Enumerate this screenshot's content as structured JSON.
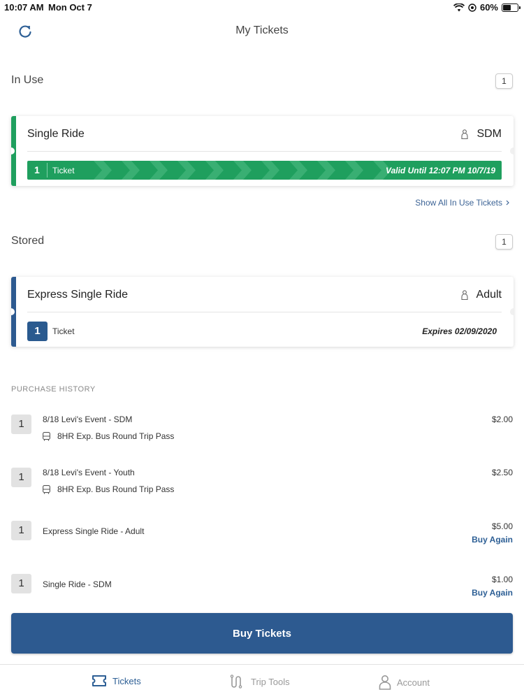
{
  "status_bar": {
    "time": "10:07 AM",
    "date": "Mon Oct 7",
    "battery": "60%",
    "battery_level": 0.6
  },
  "header": {
    "title": "My Tickets",
    "refresh_icon": "refresh-icon"
  },
  "in_use": {
    "title": "In Use",
    "count": "1",
    "ticket": {
      "name": "Single Ride",
      "rider_type": "SDM",
      "quantity": "1",
      "label": "Ticket",
      "validity": "Valid Until 12:07 PM 10/7/19"
    },
    "show_all": "Show All In Use Tickets"
  },
  "stored": {
    "title": "Stored",
    "count": "1",
    "ticket": {
      "name": "Express Single Ride",
      "rider_type": "Adult",
      "quantity": "1",
      "label": "Ticket",
      "expiry": "Expires 02/09/2020"
    }
  },
  "purchase_history": {
    "header": "PURCHASE HISTORY",
    "items": [
      {
        "qty": "1",
        "title": "8/18 Levi's Event  -  SDM",
        "sub": "8HR Exp. Bus Round Trip Pass",
        "price": "$2.00",
        "action": ""
      },
      {
        "qty": "1",
        "title": "8/18 Levi's Event  -  Youth",
        "sub": "8HR Exp. Bus Round Trip Pass",
        "price": "$2.50",
        "action": ""
      },
      {
        "qty": "1",
        "title": "Express Single Ride  -  Adult",
        "sub": "",
        "price": "$5.00",
        "action": "Buy Again"
      },
      {
        "qty": "1",
        "title": "Single Ride  -  SDM",
        "sub": "",
        "price": "$1.00",
        "action": "Buy Again"
      }
    ]
  },
  "buy_button": "Buy Tickets",
  "tabs": [
    {
      "label": "Tickets",
      "icon": "ticket-icon",
      "active": true
    },
    {
      "label": "Trip Tools",
      "icon": "route-icon",
      "active": false
    },
    {
      "label": "Account",
      "icon": "person-icon",
      "active": false
    }
  ],
  "colors": {
    "accent_green": "#1f9f5e",
    "accent_blue": "#2d5a90",
    "link": "#3d6496"
  }
}
